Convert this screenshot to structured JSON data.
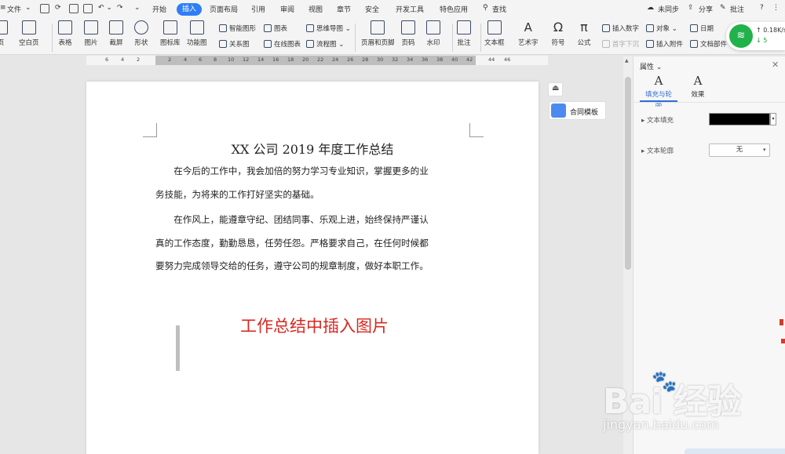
{
  "menubar": {
    "file_label": "文件",
    "tabs": [
      "开始",
      "插入",
      "页面布局",
      "引用",
      "审阅",
      "视图",
      "章节",
      "安全",
      "开发工具",
      "特色应用"
    ],
    "active_tab": "插入",
    "search_label": "查找",
    "sync_label": "未同步",
    "share_label": "分享",
    "comment_label": "批注",
    "help_label": "?"
  },
  "ribbon": {
    "page_label": "页",
    "blank_page_label": "空白页",
    "table_label": "表格",
    "image_label": "图片",
    "screenshot_label": "截屏",
    "shape_label": "形状",
    "icon_lib_label": "图标库",
    "func_chart_label": "功能图",
    "smart_shape_label": "智能图形",
    "chart_label": "图表",
    "mindmap_label": "思维导图",
    "relation_label": "关系图",
    "online_chart_label": "在线图表",
    "flowchart_label": "流程图",
    "header_footer_label": "页眉和页脚",
    "page_num_label": "页码",
    "watermark_label": "水印",
    "comment_label": "批注",
    "textbox_label": "文本框",
    "art_text_label": "艺术字",
    "symbol_label": "符号",
    "formula_label": "公式",
    "insert_number_label": "插入数字",
    "dropcap_label": "首字下沉",
    "object_label": "对象",
    "attachment_label": "插入附件",
    "date_label": "日期",
    "doc_parts_label": "文档部件"
  },
  "ruler": {
    "ticks": [
      "6",
      "4",
      "2",
      "2",
      "4",
      "6",
      "8",
      "10",
      "12",
      "14",
      "16",
      "18",
      "20",
      "22",
      "24",
      "26",
      "28",
      "30",
      "32",
      "34",
      "36",
      "38",
      "40",
      "42",
      "44",
      "46"
    ]
  },
  "document": {
    "title": "XX 公司 2019 年度工作总结",
    "lines": [
      "　　在今后的工作中，我会加倍的努力学习专业知识，掌握更多的业",
      "务技能，为将来的工作打好坚实的基础。",
      "　　在作风上，能遵章守纪、团结同事、乐观上进，始终保持严谨认",
      "真的工作态度，勤勤恳恳，任劳任怨。严格要求自己，在任何时候都",
      "要努力完成领导交给的任务，遵守公司的规章制度，做好本职工作。"
    ],
    "overlay_caption": "工作总结中插入图片"
  },
  "floating": {
    "template_label": "合同模板"
  },
  "right_pane": {
    "title": "属性",
    "tabs": [
      {
        "glyph": "A",
        "label": "填充与轮廓"
      },
      {
        "glyph": "A",
        "label": "效果"
      }
    ],
    "text_fill_label": "文本填充",
    "text_fill_color": "#000000",
    "text_outline_label": "文本轮廓",
    "text_outline_value": "无"
  },
  "network": {
    "upload": "0.18K/s",
    "download": "5"
  },
  "watermark": {
    "main": "Bai  经验",
    "sub": "jingyan.baidu.com"
  },
  "colors": {
    "accent": "#2f7ef5",
    "overlay_red": "#d9271f",
    "wifi_green": "#22b24c"
  }
}
